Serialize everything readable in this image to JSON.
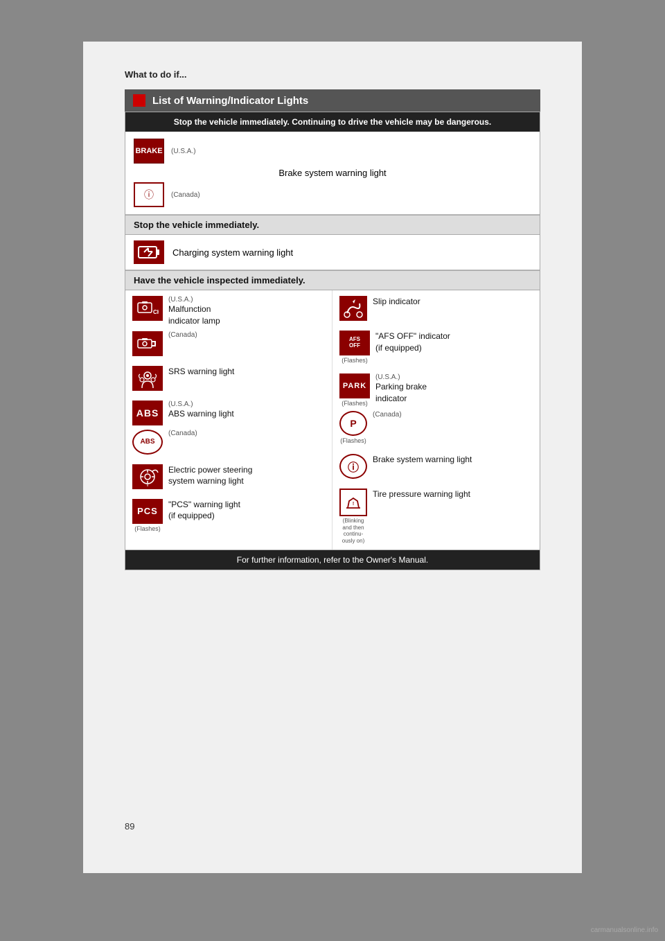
{
  "page": {
    "page_number": "89",
    "watermark": "carmanualsonline.info"
  },
  "header": {
    "what_to_do": "What to do if...",
    "section_title": "List of Warning/Indicator Lights"
  },
  "danger_notice": "Stop the vehicle immediately. Continuing to drive the vehicle may be dangerous.",
  "stop_immediate": "Stop the vehicle immediately.",
  "inspect_immediate": "Have the vehicle inspected immediately.",
  "footer": "For further information, refer to the Owner's Manual.",
  "items": {
    "brake_usa_label": "BRAKE",
    "brake_usa_sublabel": "(U.S.A.)",
    "brake_label": "Brake system warning light",
    "brake_canada_sublabel": "(Canada)",
    "charging_label": "Charging system warning light",
    "malfunction_usa": "(U.S.A.)",
    "malfunction_text": "Malfunction\nindicator lamp",
    "malfunction_canada": "(Canada)",
    "check_text": "CHECK",
    "srs_label": "SRS warning light",
    "abs_usa": "(U.S.A.)",
    "abs_label": "ABS warning light",
    "abs_canada": "(Canada)",
    "abs_text": "ABS",
    "abs_circle_text": "ABS",
    "eps_label": "Electric power steering\nsystem warning light",
    "pcs_label": "\"PCS\" warning light\n(if equipped)",
    "pcs_text": "PCS",
    "pcs_sublabel": "(Flashes)",
    "slip_label": "Slip indicator",
    "afs_label": "\"AFS OFF\" indicator\n(if equipped)",
    "afs_text": "AFS\nOFF",
    "afs_sublabel": "(Flashes)",
    "park_usa": "(U.S.A.)",
    "park_text": "PARK",
    "park_sublabel": "(Flashes)",
    "park_label": "Parking brake\nindicator",
    "park_canada": "(Canada)",
    "park_canada_sublabel": "(Flashes)",
    "brake_warn_label": "Brake system warning light",
    "tire_sublabel": "(Blinking\nand then\ncontinu-\nously on)",
    "tire_label": "Tire pressure warning light"
  }
}
